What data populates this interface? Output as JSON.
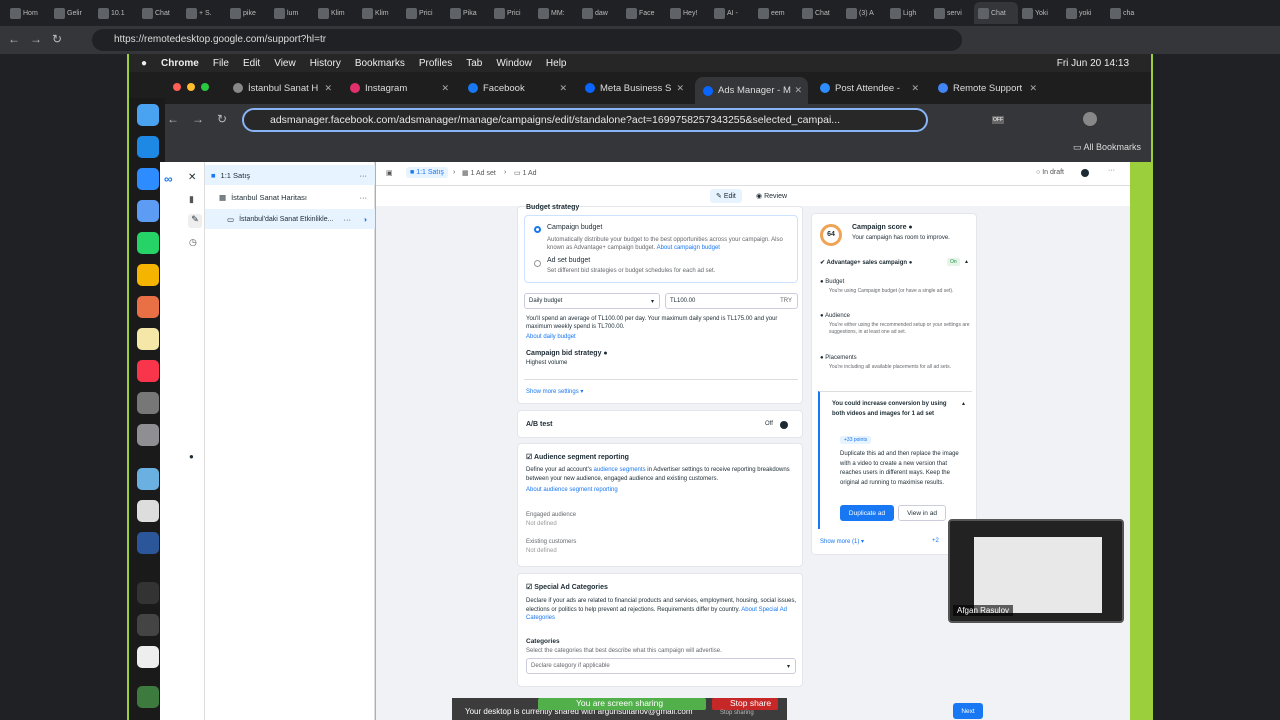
{
  "outer_browser": {
    "tabs": [
      "Hom",
      "Gelir",
      "10.1",
      "Chat",
      "+ S.",
      "pike",
      "lum",
      "Klim",
      "Klim",
      "Prici",
      "Pika",
      "Prici",
      "MM:",
      "daw",
      "Face",
      "Hey!",
      "AI -",
      "eem",
      "Chat",
      "(3) A",
      "Ligh",
      "servi",
      "Chat",
      "Yoki",
      "yoki",
      "cha"
    ],
    "url": "https://remotedesktop.google.com/support?hl=tr"
  },
  "mac_menu": {
    "items": [
      "Chrome",
      "File",
      "Edit",
      "View",
      "History",
      "Bookmarks",
      "Profiles",
      "Tab",
      "Window",
      "Help"
    ],
    "clock": "Fri Jun 20  14:13"
  },
  "chrome": {
    "tabs": [
      {
        "label": "İstanbul Sanat H",
        "color": "#888888"
      },
      {
        "label": "Instagram",
        "color": "#e1306c"
      },
      {
        "label": "Facebook",
        "color": "#1877f2"
      },
      {
        "label": "Meta Business S",
        "color": "#0866ff"
      },
      {
        "label": "Ads Manager - M",
        "color": "#0866ff"
      },
      {
        "label": "Post Attendee -",
        "color": "#2d8cff"
      },
      {
        "label": "Remote Support",
        "color": "#4285f4"
      }
    ],
    "url": "adsmanager.facebook.com/adsmanager/manage/campaigns/edit/standalone?act=1699758257343255&selected_campai...",
    "all_bookmarks": "All Bookmarks",
    "off_badge": "OFF"
  },
  "tree": {
    "campaign": "1:1 Satış",
    "adset": "İstanbul Sanat Haritası",
    "ad": "İstanbul'daki Sanat Etkinlikle..."
  },
  "breadcrumb": {
    "campaign": "1:1 Satış",
    "adset": "1 Ad set",
    "ad": "1 Ad",
    "status": "In draft"
  },
  "mode_tabs": {
    "edit": "Edit",
    "review": "Review"
  },
  "budget": {
    "section_title": "Budget strategy",
    "campaign_budget_title": "Campaign budget",
    "campaign_budget_desc": "Automatically distribute your budget to the best opportunities across your campaign. Also known as Advantage+ campaign budget.",
    "campaign_budget_link": "About campaign budget",
    "adset_budget_title": "Ad set budget",
    "adset_budget_desc": "Set different bid strategies or budget schedules for each ad set.",
    "budget_type": "Daily budget",
    "amount": "TL100.00",
    "currency": "TRY",
    "spend_note": "You'll spend an average of TL100.00 per day. Your maximum daily spend is TL175.00 and your maximum weekly spend is TL700.00.",
    "daily_link": "About daily budget",
    "bid_title": "Campaign bid strategy",
    "bid_value": "Highest volume",
    "more_settings": "Show more settings ▾"
  },
  "ab_test": {
    "title": "A/B test",
    "state": "Off"
  },
  "audience": {
    "title": "Audience segment reporting",
    "desc_a": "Define your ad account's",
    "desc_link": "audience segments",
    "desc_b": "in Advertiser settings to receive reporting breakdowns between your new audience, engaged audience and existing customers.",
    "link": "About audience segment reporting",
    "engaged_label": "Engaged audience",
    "engaged_value": "Not defined",
    "existing_label": "Existing customers",
    "existing_value": "Not defined"
  },
  "special": {
    "title": "Special Ad Categories",
    "desc": "Declare if your ads are related to financial products and services, employment, housing, social issues, elections or politics to help prevent ad rejections. Requirements differ by country.",
    "link": "About Special Ad Categories",
    "categories_label": "Categories",
    "categories_desc": "Select the categories that best describe what this campaign will advertise.",
    "placeholder": "Declare category if applicable"
  },
  "score": {
    "value": "64",
    "title": "Campaign score",
    "subtitle": "Your campaign has room to improve.",
    "advantage_title": "Advantage+ sales campaign",
    "advantage_state": "On",
    "budget_title": "Budget",
    "budget_desc": "You're using Campaign budget (or have a single ad set).",
    "audience_title": "Audience",
    "audience_desc": "You're either using the recommended setup or your settings are suggestions, in at least one ad set.",
    "placements_title": "Placements",
    "placements_desc": "You're including all available placements for all ad sets.",
    "tip_title": "You could increase conversion by using both videos and images for 1 ad set",
    "tip_points": "+33 points",
    "tip_desc": "Duplicate this ad and then replace the image with a video to create a new version that reaches users in different ways. Keep the original ad running to maximise results.",
    "duplicate": "Duplicate ad",
    "view": "View in ad",
    "show_more": "Show more (1) ▾",
    "plus": "+2"
  },
  "share_bar": {
    "sharing": "You are screen sharing",
    "stop": "Stop share",
    "desktop": "Your desktop is currently shared with argunsultanov@gmail.com",
    "stop_sharing": "Stop sharing"
  },
  "next": "Next",
  "video_name": "Afgan Rasulov"
}
